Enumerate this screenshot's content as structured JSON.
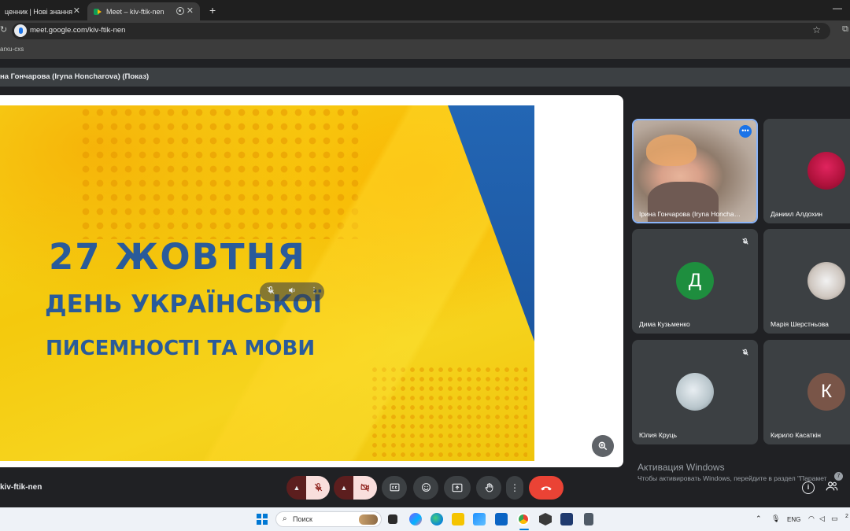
{
  "browser": {
    "tabs": [
      {
        "title": "ценник | Нові знання",
        "active": false
      },
      {
        "title": "Meet – kiv-ftik-nen",
        "active": true
      }
    ],
    "url": "meet.google.com/kiv-ftik-nen",
    "bookmark": "arxu-cxs"
  },
  "meeting": {
    "presenter_label": "на Гончарова (Iryna Honcharova) (Показ)",
    "code": "kiv-ftik-nen"
  },
  "slide": {
    "title": "27 ЖОВТНЯ",
    "line2": "ДЕНЬ УКРАЇНСЬКОЇ",
    "line3": "ПИСЕМНОСТІ ТА МОВИ"
  },
  "participants": [
    {
      "name": "Ірина Гончарова (Iryna Honcha…",
      "avatar": "",
      "video": true,
      "muted": false
    },
    {
      "name": "Даниил Алдохин",
      "avatar": "",
      "video": false,
      "muted": false
    },
    {
      "name": "Дима Кузьменко",
      "avatar": "Д",
      "video": false,
      "muted": true
    },
    {
      "name": "Марія Шерстньова",
      "avatar": "",
      "video": false,
      "muted": false
    },
    {
      "name": "Юлия Круць",
      "avatar": "",
      "video": false,
      "muted": true
    },
    {
      "name": "Кирило Касаткін",
      "avatar": "К",
      "video": false,
      "muted": false
    }
  ],
  "windows_watermark": {
    "title": "Активация Windows",
    "subtitle": "Чтобы активировать Windows, перейдите в раздел \"Парамет"
  },
  "badge_count": "7",
  "taskbar": {
    "search_placeholder": "Поиск",
    "language": "ENG",
    "clock": "2"
  },
  "colors": {
    "leave": "#ea4335",
    "accent": "#1a73e8",
    "slide_text": "#2a5b9a"
  },
  "icons": {
    "mic": "mic-off-icon",
    "camera": "camera-off-icon",
    "captions": "captions-icon",
    "emoji": "emoji-icon",
    "present": "present-icon",
    "hand": "raise-hand-icon",
    "more": "more-vert-icon",
    "leave": "leave-call-icon",
    "info": "info-icon",
    "people": "people-icon"
  }
}
